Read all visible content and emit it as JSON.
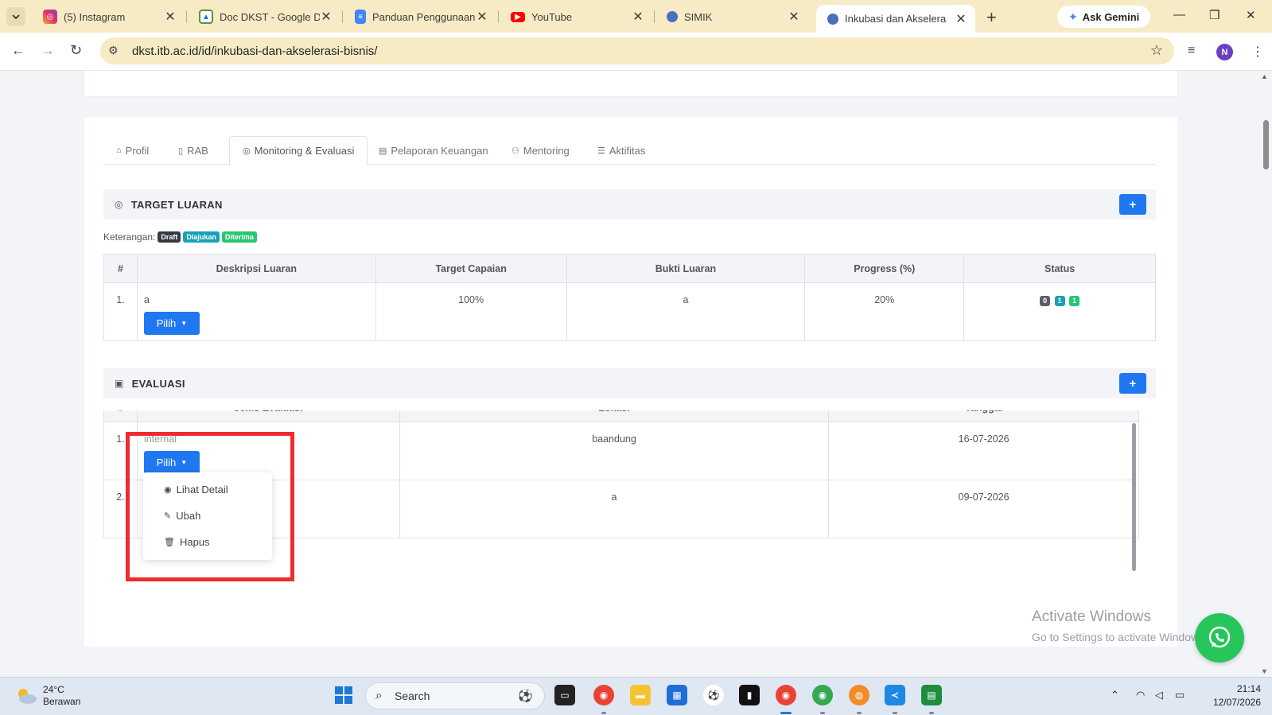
{
  "browser": {
    "tabs": [
      {
        "title": "(5) Instagram",
        "icon": "instagram-icon",
        "color": "#e1306c"
      },
      {
        "title": "Doc DKST - Google Dr",
        "icon": "google-drive-icon",
        "color": "#1a73e8"
      },
      {
        "title": "Panduan Penggunaan",
        "icon": "google-docs-icon",
        "color": "#4285f4"
      },
      {
        "title": "YouTube",
        "icon": "youtube-icon",
        "color": "#ff0000"
      },
      {
        "title": "SIMIK",
        "icon": "globe-icon",
        "color": "#4a6fbf"
      },
      {
        "title": "Inkubasi dan Akselera",
        "icon": "globe-icon",
        "color": "#4a6fbf"
      }
    ],
    "active_tab": 5,
    "ask_gemini": "Ask Gemini",
    "url": "dkst.itb.ac.id/id/inkubasi-dan-akselerasi-bisnis/",
    "profile_initial": "N"
  },
  "page": {
    "nav_tabs": [
      {
        "label": "Profil",
        "icon": "home-icon"
      },
      {
        "label": "RAB",
        "icon": "document-icon"
      },
      {
        "label": "Monitoring & Evaluasi",
        "icon": "target-icon"
      },
      {
        "label": "Pelaporan Keuangan",
        "icon": "money-icon"
      },
      {
        "label": "Mentoring",
        "icon": "users-icon"
      },
      {
        "label": "Aktifitas",
        "icon": "list-icon"
      }
    ],
    "active_nav_tab": 2,
    "target": {
      "title": "TARGET LUARAN",
      "add_label": "+",
      "keterangan_label": "Keterangan:",
      "legend": [
        {
          "label": "Draft",
          "color": "#343a40"
        },
        {
          "label": "Diajukan",
          "color": "#17a2b8"
        },
        {
          "label": "Diterima",
          "color": "#28c76f"
        }
      ],
      "columns": [
        "#",
        "Deskripsi Luaran",
        "Target Capaian",
        "Bukti Luaran",
        "Progress (%)",
        "Status"
      ],
      "rows": [
        {
          "no": "1.",
          "deskripsi": "a",
          "target": "100%",
          "bukti": "a",
          "progress": "20%",
          "status": [
            "0",
            "1",
            "1"
          ]
        }
      ],
      "action_label": "Pilih"
    },
    "evaluasi": {
      "title": "EVALUASI",
      "add_label": "+",
      "columns": [
        "#",
        "Jenis Evaluasi",
        "Lokasi",
        "Tanggal"
      ],
      "rows": [
        {
          "no": "1.",
          "jenis": "internal",
          "lokasi": "baandung",
          "tanggal": "16-07-2026"
        },
        {
          "no": "2.",
          "jenis": "",
          "lokasi": "a",
          "tanggal": "09-07-2026"
        }
      ],
      "action_label": "Pilih",
      "dropdown": [
        {
          "label": "Lihat Detail",
          "icon": "eye-icon"
        },
        {
          "label": "Ubah",
          "icon": "pencil-icon"
        },
        {
          "label": "Hapus",
          "icon": "trash-icon"
        }
      ]
    },
    "watermark": {
      "line1": "Activate Windows",
      "line2": "Go to Settings to activate Windows."
    }
  },
  "taskbar": {
    "temp": "24°C",
    "condition": "Berawan",
    "search_placeholder": "Search",
    "time": "21:14",
    "date": "12/07/2026"
  }
}
